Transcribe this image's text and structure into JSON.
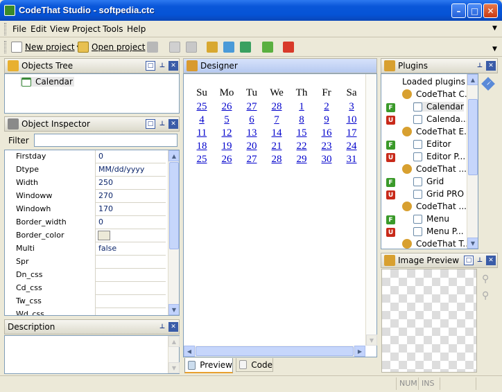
{
  "window": {
    "title": "CodeThat Studio - softpedia.ctc"
  },
  "menu": [
    "File",
    "Edit",
    "View",
    "Project",
    "Tools",
    "Help"
  ],
  "toolbar": {
    "new_project": "New project",
    "open_project": "Open project"
  },
  "objects_tree": {
    "title": "Objects Tree",
    "items": [
      "Calendar"
    ]
  },
  "object_inspector": {
    "title": "Object Inspector",
    "filter_label": "Filter",
    "filter_value": "",
    "properties": [
      {
        "name": "Firstday",
        "value": "0"
      },
      {
        "name": "Dtype",
        "value": "MM/dd/yyyy"
      },
      {
        "name": "Width",
        "value": "250"
      },
      {
        "name": "Windoww",
        "value": "270"
      },
      {
        "name": "Windowh",
        "value": "170"
      },
      {
        "name": "Border_width",
        "value": "0"
      },
      {
        "name": "Border_color",
        "value": ""
      },
      {
        "name": "Multi",
        "value": "false"
      },
      {
        "name": "Spr",
        "value": ""
      },
      {
        "name": "Dn_css",
        "value": ""
      },
      {
        "name": "Cd_css",
        "value": ""
      },
      {
        "name": "Tw_css",
        "value": ""
      },
      {
        "name": "Wd_css",
        "value": ""
      }
    ]
  },
  "description": {
    "title": "Description"
  },
  "designer": {
    "title": "Designer",
    "weekdays": [
      "Su",
      "Mo",
      "Tu",
      "We",
      "Th",
      "Fr",
      "Sa"
    ],
    "weeks": [
      [
        "25",
        "26",
        "27",
        "28",
        "1",
        "2",
        "3"
      ],
      [
        "4",
        "5",
        "6",
        "7",
        "8",
        "9",
        "10"
      ],
      [
        "11",
        "12",
        "13",
        "14",
        "15",
        "16",
        "17"
      ],
      [
        "18",
        "19",
        "20",
        "21",
        "22",
        "23",
        "24"
      ],
      [
        "25",
        "26",
        "27",
        "28",
        "29",
        "30",
        "31"
      ]
    ],
    "tabs": [
      "Preview",
      "Code"
    ]
  },
  "plugins": {
    "title": "Plugins",
    "items": [
      {
        "label": "Loaded plugins",
        "badge": ""
      },
      {
        "label": "CodeThat C...",
        "badge": ""
      },
      {
        "label": "Calendar",
        "badge": "F"
      },
      {
        "label": "Calenda...",
        "badge": "U"
      },
      {
        "label": "CodeThat E...",
        "badge": ""
      },
      {
        "label": "Editor",
        "badge": "F"
      },
      {
        "label": "Editor P...",
        "badge": "U"
      },
      {
        "label": "CodeThat ...",
        "badge": ""
      },
      {
        "label": "Grid",
        "badge": "F"
      },
      {
        "label": "Grid PRO",
        "badge": "U"
      },
      {
        "label": "CodeThat ...",
        "badge": ""
      },
      {
        "label": "Menu",
        "badge": "F"
      },
      {
        "label": "Menu P...",
        "badge": "U"
      },
      {
        "label": "CodeThat T...",
        "badge": ""
      }
    ]
  },
  "image_preview": {
    "title": "Image Preview"
  },
  "status": {
    "num": "NUM",
    "ins": "INS"
  },
  "colors": {
    "title_bar": "#0a57d9",
    "link": "#0000cc",
    "panel_border": "#7f9db9"
  }
}
